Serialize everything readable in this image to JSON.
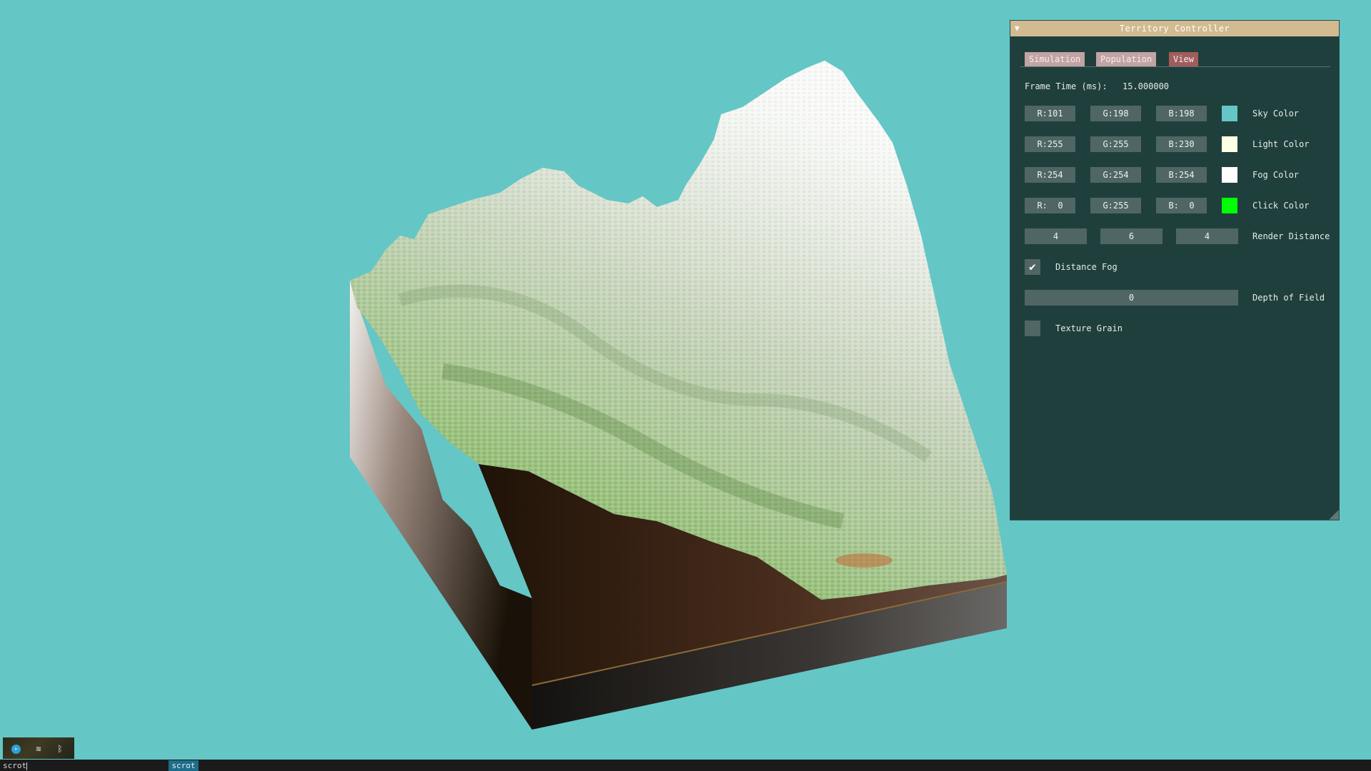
{
  "panel": {
    "title": "Territory Controller",
    "tabs": [
      "Simulation",
      "Population",
      "View"
    ],
    "active_tab": "View",
    "frame_time_label": "Frame Time (ms):",
    "frame_time_value": "15.000000",
    "sky": {
      "r": "R:101",
      "g": "G:198",
      "b": "B:198",
      "label": "Sky Color",
      "swatch": "#65c6c6"
    },
    "light": {
      "r": "R:255",
      "g": "G:255",
      "b": "B:230",
      "label": "Light Color",
      "swatch": "#ffffe6"
    },
    "fog": {
      "r": "R:254",
      "g": "G:254",
      "b": "B:254",
      "label": "Fog Color",
      "swatch": "#fefefe"
    },
    "click": {
      "r": "R:  0",
      "g": "G:255",
      "b": "B:  0",
      "label": "Click Color",
      "swatch": "#00ff00"
    },
    "render_distance": {
      "x": "4",
      "y": "6",
      "z": "4",
      "label": "Render Distance"
    },
    "distance_fog": {
      "label": "Distance Fog",
      "checked": true
    },
    "depth_of_field": {
      "value": "0",
      "label": "Depth of Field"
    },
    "texture_grain": {
      "label": "Texture Grain",
      "checked": false
    }
  },
  "taskbar": {
    "command": "scrot",
    "window_tab": "scrot"
  },
  "tray_icons": [
    "telegram-icon",
    "wifi-icon",
    "bluetooth-icon"
  ],
  "colors": {
    "background": "#65c6c6",
    "panel_bg": "#1f3f3d",
    "title_bar": "#d2ba91",
    "tab": "#c3a3a3",
    "tab_active": "#a25c5c",
    "field": "#4f6664"
  }
}
